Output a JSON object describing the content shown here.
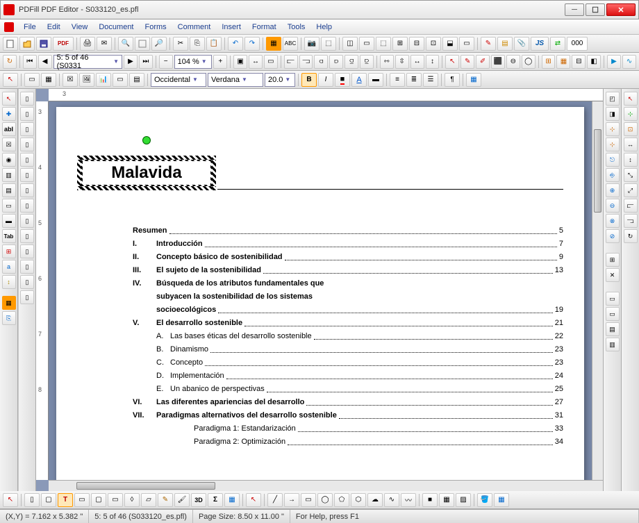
{
  "window": {
    "title": "PDFill PDF Editor - S033120_es.pfl"
  },
  "menu": [
    "File",
    "Edit",
    "View",
    "Document",
    "Forms",
    "Comment",
    "Insert",
    "Format",
    "Tools",
    "Help"
  ],
  "nav": {
    "page_label": "5: 5 of 46 (S0331",
    "zoom": "104 %"
  },
  "font": {
    "charset": "Occidental",
    "family": "Verdana",
    "size": "20.0"
  },
  "badges": {
    "js": "JS",
    "triple0": "000",
    "pdf": "PDF",
    "tab": "Tab",
    "a_label": "a",
    "abl": "abI",
    "threeD": "3D"
  },
  "selection": {
    "text": "Malavida"
  },
  "toc": [
    {
      "num": "",
      "txt": "Resumen",
      "pg": "5",
      "bold": true,
      "nn": true
    },
    {
      "num": "I.",
      "txt": "Introducción",
      "pg": "7",
      "bold": true
    },
    {
      "num": "II.",
      "txt": "Concepto básico de sostenibilidad",
      "pg": "9",
      "bold": true
    },
    {
      "num": "III.",
      "txt": "El sujeto de la sostenibilidad",
      "pg": "13",
      "bold": true
    },
    {
      "num": "IV.",
      "txt": "Búsqueda de los atributos fundamentales que",
      "pg": "",
      "bold": true,
      "nodots": true
    },
    {
      "num": "",
      "txt": "subyacen la sostenibilidad de los sistemas",
      "pg": "",
      "bold": true,
      "nn": true,
      "nodots": true,
      "cont": true
    },
    {
      "num": "",
      "txt": "socioecológicos",
      "pg": "19",
      "bold": true,
      "nn": true,
      "cont": true
    },
    {
      "num": "V.",
      "txt": "El desarrollo sostenible",
      "pg": "21",
      "bold": true
    },
    {
      "num": "A.",
      "txt": "Las bases éticas del desarrollo sostenible",
      "pg": "22",
      "sub": true
    },
    {
      "num": "B.",
      "txt": "Dinamismo",
      "pg": "23",
      "sub": true
    },
    {
      "num": "C.",
      "txt": "Concepto",
      "pg": "23",
      "sub": true
    },
    {
      "num": "D.",
      "txt": "Implementación",
      "pg": "24",
      "sub": true
    },
    {
      "num": "E.",
      "txt": "Un abanico de perspectivas",
      "pg": "25",
      "sub": true
    },
    {
      "num": "VI.",
      "txt": "Las diferentes apariencias del desarrollo",
      "pg": "27",
      "bold": true
    },
    {
      "num": "VII.",
      "txt": "Paradigmas alternativos del desarrollo sostenible",
      "pg": "31",
      "bold": true
    },
    {
      "num": "",
      "txt": "Paradigma 1: Estandarización",
      "pg": "33",
      "nn": true,
      "sub": true
    },
    {
      "num": "",
      "txt": "Paradigma 2: Optimización",
      "pg": "34",
      "nn": true,
      "sub": true
    }
  ],
  "status": {
    "coords": "(X,Y) = 7.162 x 5.382 \"",
    "page": "5: 5 of 46 (S033120_es.pfl)",
    "size": "Page Size: 8.50 x 11.00 \"",
    "help": "For Help, press F1"
  }
}
